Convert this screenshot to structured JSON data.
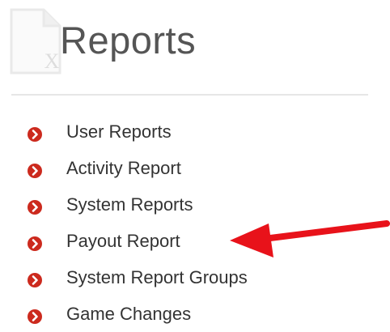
{
  "header": {
    "title": "Reports",
    "icon": "excel-file-icon",
    "icon_letter": "X"
  },
  "reports": {
    "items": [
      {
        "label": "User Reports",
        "icon": "arrow-circle-right-icon"
      },
      {
        "label": "Activity Report",
        "icon": "arrow-circle-right-icon"
      },
      {
        "label": "System Reports",
        "icon": "arrow-circle-right-icon"
      },
      {
        "label": "Payout Report",
        "icon": "arrow-circle-right-icon"
      },
      {
        "label": "System Report Groups",
        "icon": "arrow-circle-right-icon"
      },
      {
        "label": "Game Changes",
        "icon": "arrow-circle-right-icon"
      }
    ]
  },
  "annotation": {
    "icon": "red-arrow-pointer",
    "color": "#e8121a",
    "points_to": "Payout Report"
  },
  "colors": {
    "bullet": "#cc2a1e",
    "title": "#555555",
    "text": "#333333",
    "divider": "#e6e6e6"
  }
}
